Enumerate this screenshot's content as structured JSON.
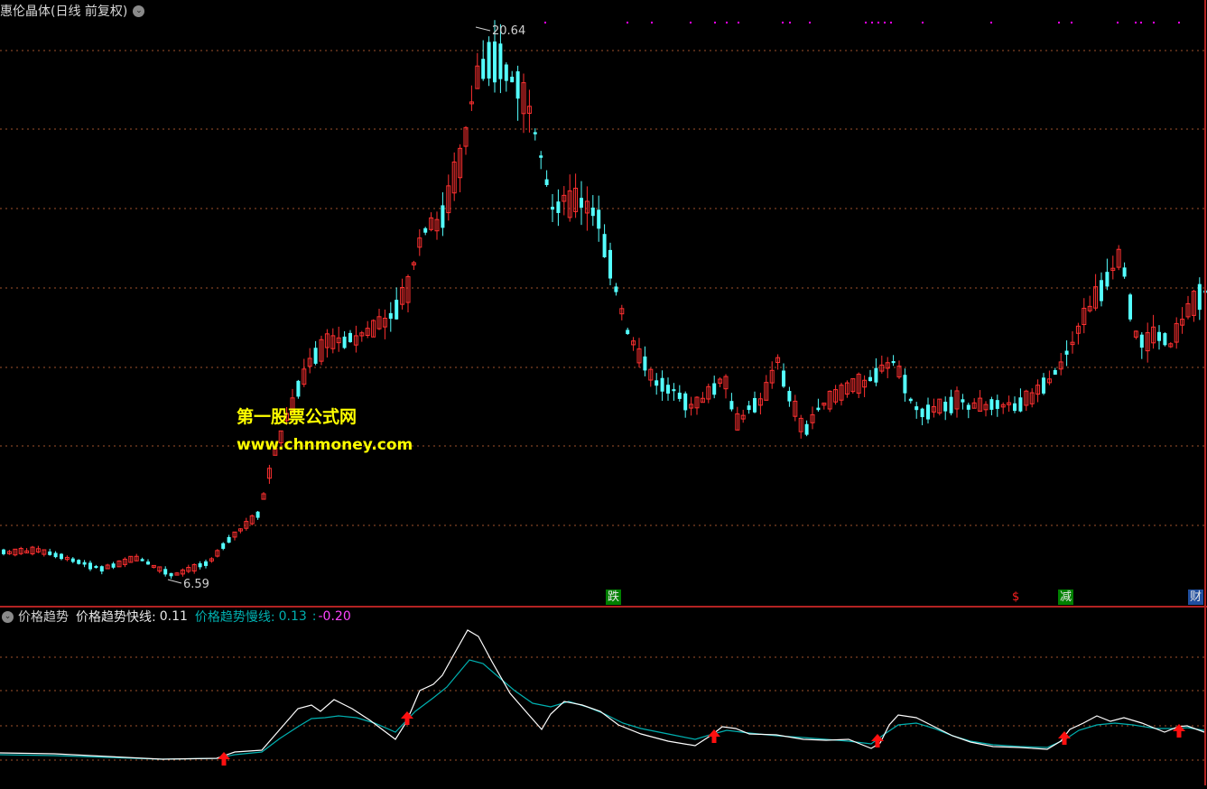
{
  "header": {
    "stock_name": "惠伦晶体",
    "period_info": "(日线 前复权)",
    "dropdown_icon": "chevron-down-icon"
  },
  "price_panel": {
    "max_label": "20.64",
    "min_label": "6.59",
    "up_color": "#ff3030",
    "down_color": "#54ffff",
    "grid_color": "#a0522d",
    "markers_color": "#ff00ff"
  },
  "watermark": {
    "line1": "第一股票公式网",
    "line2": "www.chnmoney.com"
  },
  "event_tags": [
    {
      "text": "跌",
      "color": "#e8e8e8",
      "bg": "#008000"
    },
    {
      "text": "$",
      "color": "#ff2020",
      "bg": "transparent"
    },
    {
      "text": "减",
      "color": "#e8e8e8",
      "bg": "#008000"
    },
    {
      "text": "财",
      "color": "#e8e8e8",
      "bg": "#1f4e9e"
    }
  ],
  "indicator": {
    "name": "价格趋势",
    "fast_label": "价格趋势快线:",
    "fast_value": "0.11",
    "slow_label": "价格趋势慢线:",
    "slow_value": "0.13",
    "extra_sep": ":",
    "extra_value": "-0.20",
    "fast_color": "#ffffff",
    "slow_color": "#00b0b0",
    "extra_color": "#ff44ff",
    "arrow_color": "#ff1010"
  }
}
